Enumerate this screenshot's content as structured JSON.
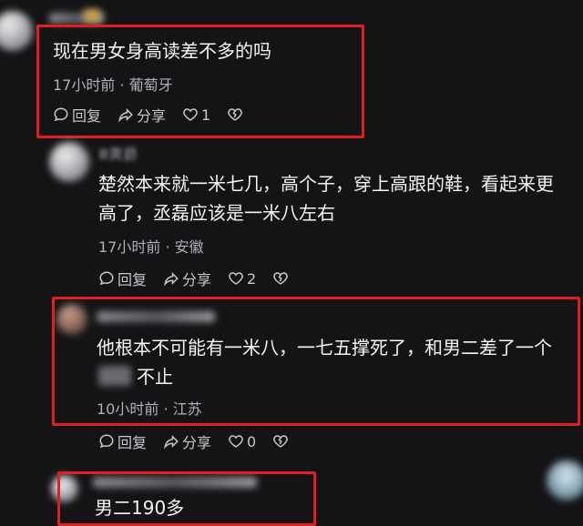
{
  "comments": [
    {
      "text": "现在男女身高读差不多的吗",
      "meta": "17小时前 · 葡萄牙",
      "reply": "回复",
      "share": "分享",
      "likes": "1"
    },
    {
      "name": "Ⅲ黄爵",
      "text_line1": "楚然本来就一米七几，高个子，穿上高跟的鞋，看起来更",
      "text_line2": "高了，丞磊应该是一米八左右",
      "meta": "17小时前 · 安徽",
      "reply": "回复",
      "share": "分享",
      "likes": "2"
    },
    {
      "text_line1": "他根本不可能有一米八，一七五撑死了，和男二差了一个",
      "text_line2": "不止",
      "meta": "10小时前 · 江苏",
      "reply": "回复",
      "share": "分享",
      "likes": "0"
    },
    {
      "text": "男二190多"
    }
  ],
  "colors": {
    "highlight": "#e02020",
    "background": "#141416"
  }
}
